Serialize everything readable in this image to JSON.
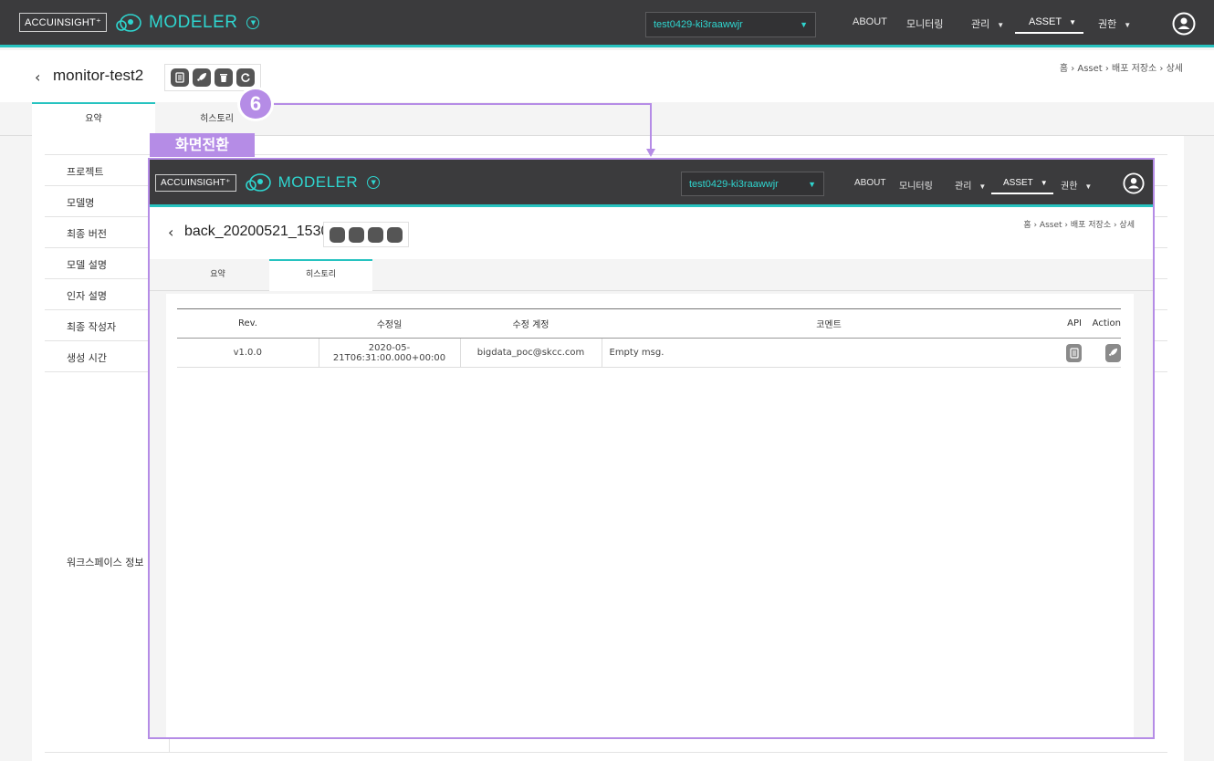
{
  "header": {
    "brand_box": "ACCUINSIGHT⁺",
    "brand_name": "MODELER",
    "project": "test0429-ki3raawwjr",
    "nav": [
      "ABOUT",
      "모니터링",
      "관리",
      "ASSET",
      "권한"
    ]
  },
  "page": {
    "title": "monitor-test2",
    "breadcrumb": "홈  ›  Asset  ›  배포 저장소  ›  상세"
  },
  "tabs": [
    "요약",
    "히스토리"
  ],
  "summary": {
    "labels": [
      "프로젝트",
      "모델명",
      "최종 버전",
      "모델 설명",
      "인자 설명",
      "최종 작성자",
      "생성 시간",
      "워크스페이스 정보"
    ]
  },
  "annotation": {
    "badge": "6",
    "label": "화면전환"
  },
  "overlay": {
    "title": "back_20200521_1530",
    "table": {
      "headers": [
        "Rev.",
        "수정일",
        "수정 계정",
        "코멘트",
        "API",
        "Action"
      ],
      "rows": [
        [
          "v1.0.0",
          "2020-05-21T06:31:00.000+00:00",
          "bigdata_poc@skcc.com",
          "Empty msg."
        ]
      ]
    }
  }
}
